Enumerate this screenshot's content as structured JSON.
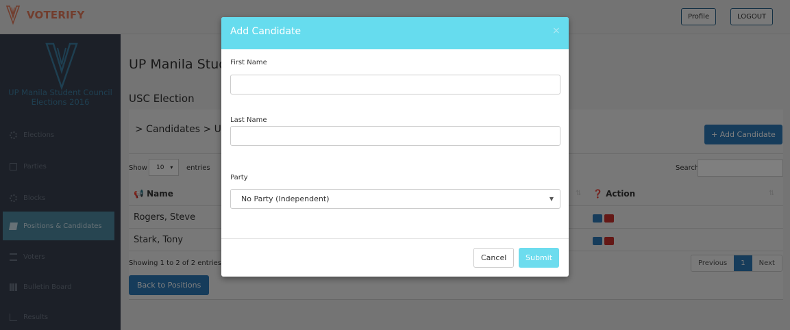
{
  "header": {
    "brand": "VOTERIFY",
    "profile_label": "Profile",
    "logout_label": "LOGOUT"
  },
  "sidebar": {
    "title": "UP Manila Student Council Elections 2016",
    "items": [
      {
        "label": "Elections",
        "icon": "dashboard-icon"
      },
      {
        "label": "Parties",
        "icon": "monitor-icon"
      },
      {
        "label": "Blocks",
        "icon": "cogs-icon"
      },
      {
        "label": "Positions & Candidates",
        "icon": "book-icon",
        "active": true
      },
      {
        "label": "Voters",
        "icon": "list-icon"
      },
      {
        "label": "Bulletin Board",
        "icon": "grid-icon"
      },
      {
        "label": "Results",
        "icon": "chart-icon"
      }
    ]
  },
  "main": {
    "title": "UP Manila Stud",
    "subtitle": "USC Election",
    "breadcrumb": "> Candidates > USC",
    "add_candidate_label": "+ Add Candidate",
    "show_label": "Show",
    "page_size": "10",
    "entries_label": "entries",
    "search_label": "Search:",
    "columns": {
      "name": "Name",
      "action": "Action"
    },
    "rows": [
      {
        "name": "Rogers, Steve"
      },
      {
        "name": "Stark, Tony"
      }
    ],
    "showing": "Showing 1 to 2 of 2 entries",
    "pagination": {
      "previous": "Previous",
      "current": "1",
      "next": "Next"
    },
    "back_label": "Back to Positions"
  },
  "modal": {
    "title": "Add Candidate",
    "close": "×",
    "first_name_label": "First Name",
    "first_name_value": "",
    "last_name_label": "Last Name",
    "last_name_value": "",
    "party_label": "Party",
    "party_selected": "No Party (Independent)",
    "cancel_label": "Cancel",
    "submit_label": "Submit"
  },
  "colors": {
    "brand": "#e57b5b",
    "sidebar_bg": "#394150",
    "sidebar_active": "#4f8ba3",
    "primary": "#2d78b6",
    "modal_header": "#66dcee",
    "danger": "#c9302c"
  }
}
